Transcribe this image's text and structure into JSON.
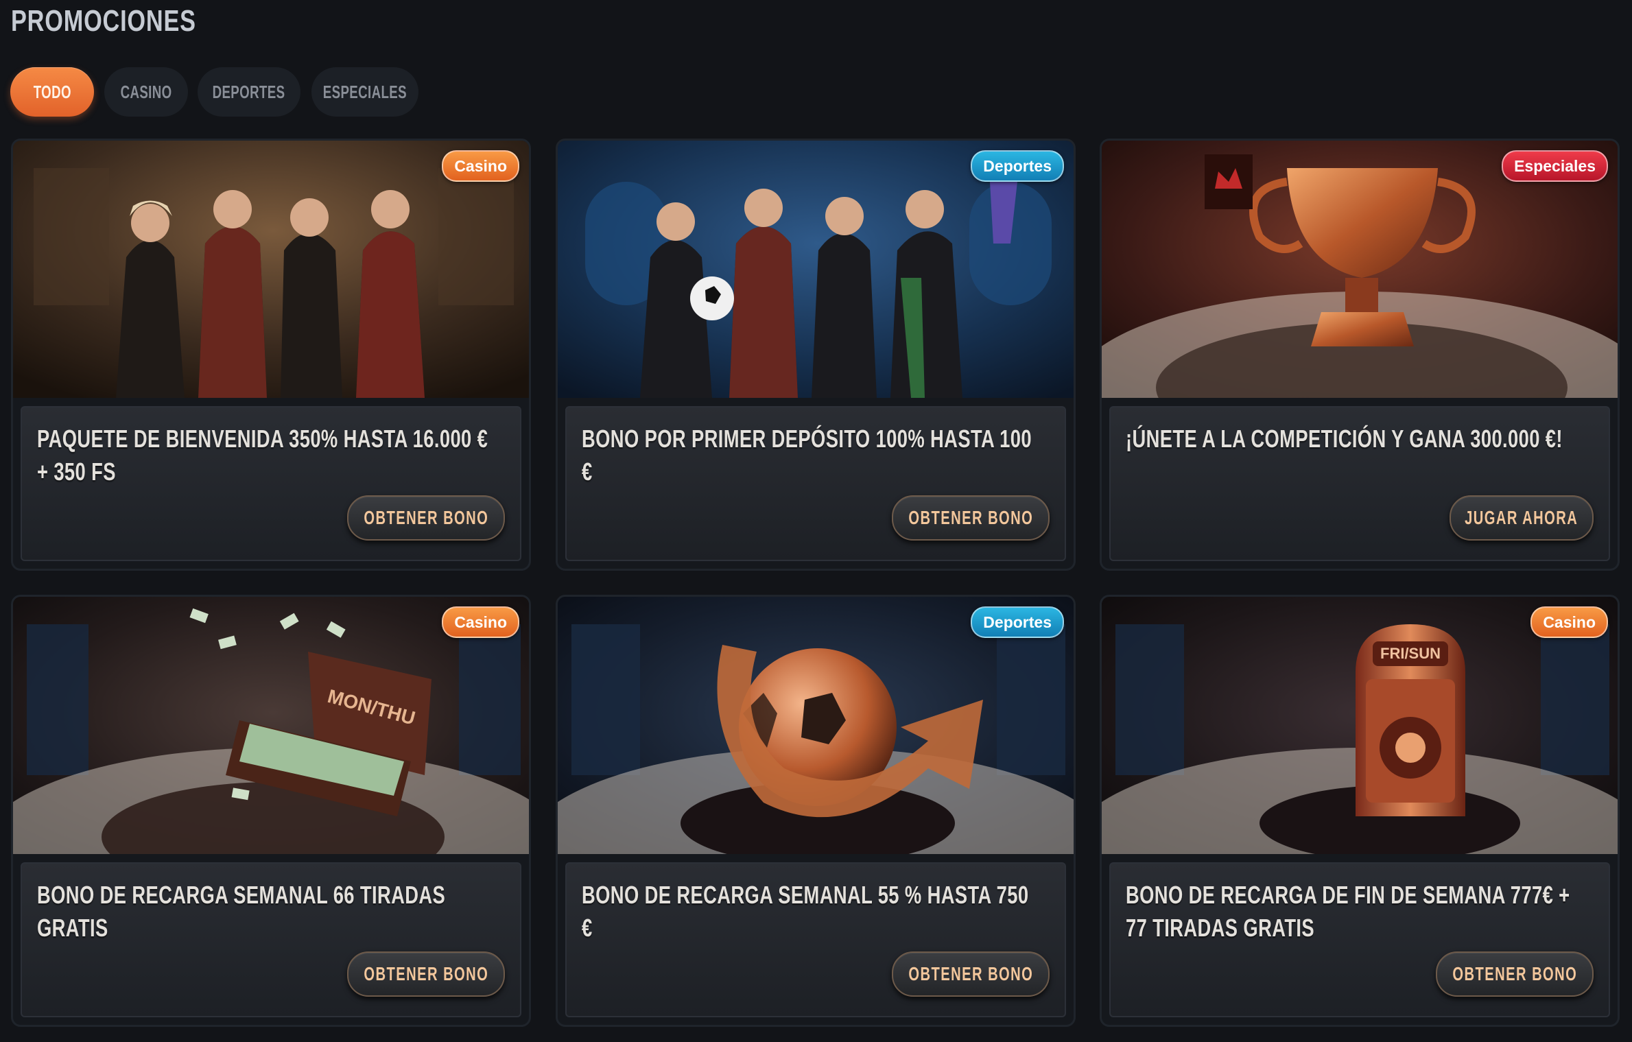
{
  "page_title": "PROMOCIONES",
  "tabs": [
    {
      "label": "TODO",
      "active": true
    },
    {
      "label": "CASINO",
      "active": false
    },
    {
      "label": "DEPORTES",
      "active": false
    },
    {
      "label": "ESPECIALES",
      "active": false
    }
  ],
  "badge_colors": {
    "Casino": "#f07a2a",
    "Deportes": "#1b9fd0",
    "Especiales": "#d8283a"
  },
  "cards": [
    {
      "badge": "Casino",
      "image": "four-characters-casino-lounge",
      "title": "PAQUETE DE BIENVENIDA 350% HASTA 16.000 € + 350 FS",
      "button": "OBTENER BONO"
    },
    {
      "badge": "Deportes",
      "image": "four-characters-sports-bar-football",
      "title": "BONO POR PRIMER DEPÓSITO 100% HASTA 100 €",
      "button": "OBTENER BONO"
    },
    {
      "badge": "Especiales",
      "image": "gold-trophy-cup",
      "title": "¡ÚNETE A LA COMPETICIÓN Y GANA 300.000 €!",
      "button": "JUGAR AHORA"
    },
    {
      "badge": "Casino",
      "image": "suitcase-of-money",
      "image_text": "MON/THU",
      "title": "BONO DE RECARGA SEMANAL 66 TIRADAS GRATIS",
      "button": "OBTENER BONO"
    },
    {
      "badge": "Deportes",
      "image": "bronze-football-arrow",
      "title": "BONO DE RECARGA SEMANAL 55 % HASTA 750 €",
      "button": "OBTENER BONO"
    },
    {
      "badge": "Casino",
      "image": "vault-safe",
      "image_text": "FRI/SUN",
      "title": "BONO DE RECARGA DE FIN DE SEMANA 777€ + 77 TIRADAS GRATIS",
      "button": "OBTENER BONO"
    }
  ]
}
